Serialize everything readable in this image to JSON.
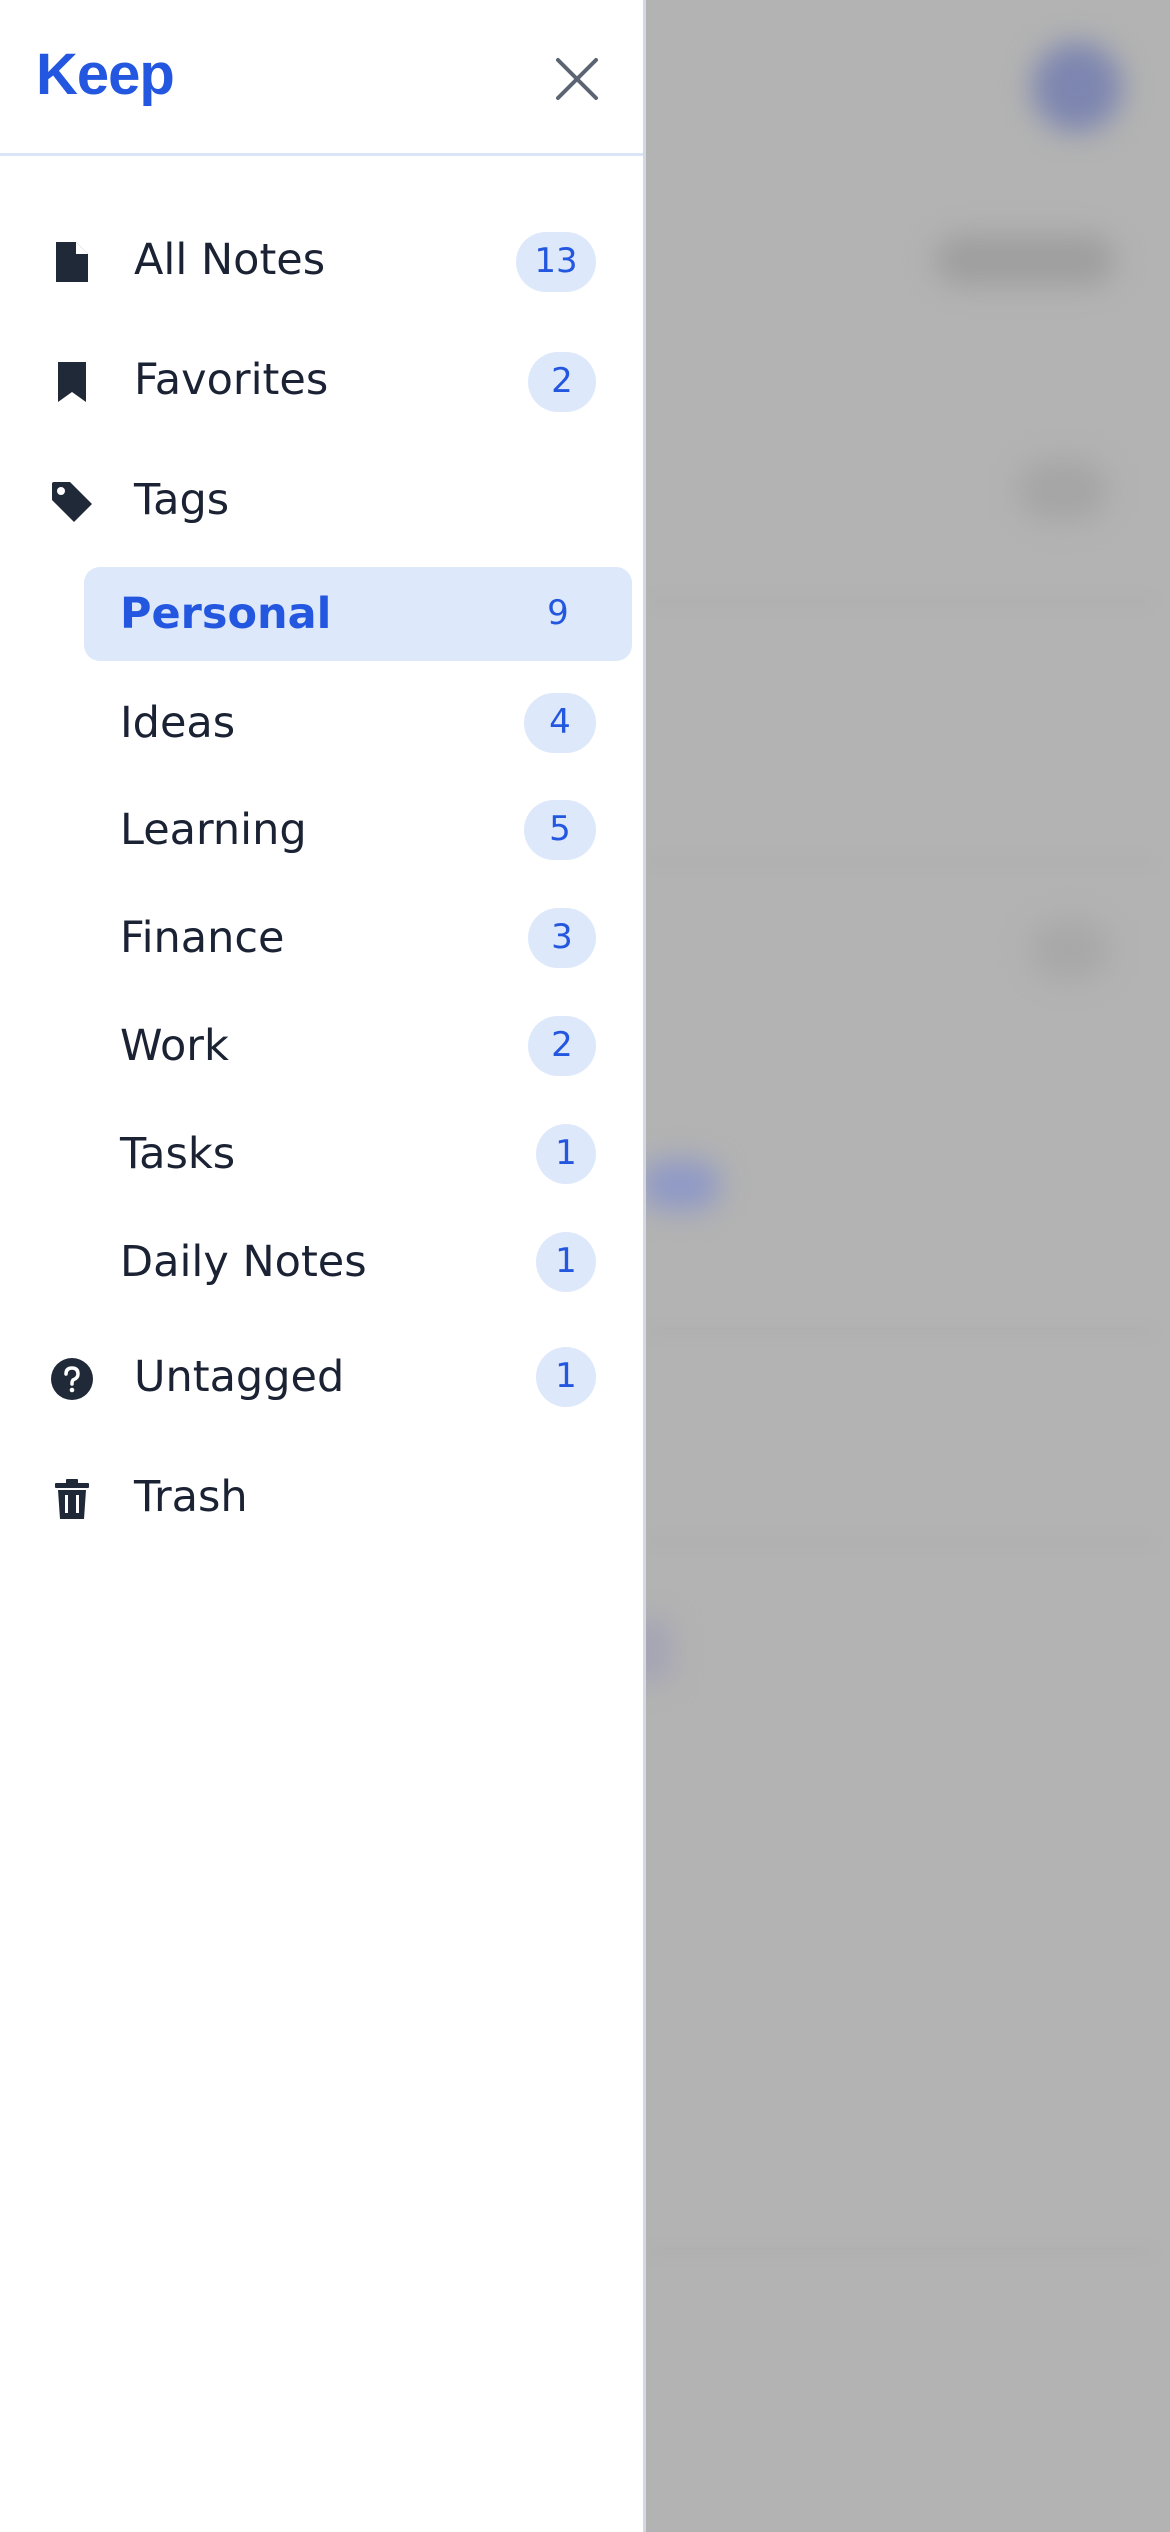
{
  "app": {
    "logo_text": "Keep",
    "accent_color": "#2457e0",
    "badge_bg_color": "#dde8fb"
  },
  "drawer": {
    "close_icon": "close-icon",
    "main_items": [
      {
        "label": "All Notes",
        "count": "13",
        "icon": "document-icon"
      },
      {
        "label": "Favorites",
        "count": "2",
        "icon": "bookmark-icon"
      },
      {
        "label": "Tags",
        "count": "",
        "icon": "tag-icon"
      }
    ],
    "tags": [
      {
        "label": "Personal",
        "count": "9",
        "active": true
      },
      {
        "label": "Ideas",
        "count": "4",
        "active": false
      },
      {
        "label": "Learning",
        "count": "5",
        "active": false
      },
      {
        "label": "Finance",
        "count": "3",
        "active": false
      },
      {
        "label": "Work",
        "count": "2",
        "active": false
      },
      {
        "label": "Tasks",
        "count": "1",
        "active": false
      },
      {
        "label": "Daily Notes",
        "count": "1",
        "active": false
      }
    ],
    "bottom_items": [
      {
        "label": "Untagged",
        "count": "1",
        "icon": "question-circle-icon"
      },
      {
        "label": "Trash",
        "count": "",
        "icon": "trash-icon"
      }
    ]
  }
}
